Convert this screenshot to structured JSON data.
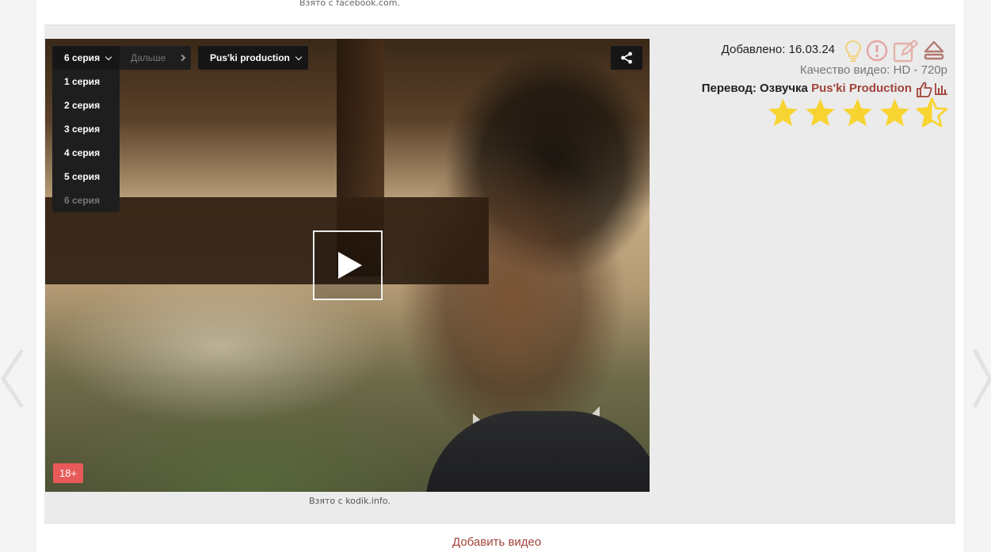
{
  "top_caption": "Взято с facebook.com.",
  "player": {
    "episode_selected": "6 серия",
    "next_label": "Дальше",
    "voice_selected": "Pus'ki production",
    "episodes": [
      "1 серия",
      "2 серия",
      "3 серия",
      "4 серия",
      "5 серия",
      "6 серия"
    ],
    "age_rating": "18+",
    "caption": "Взято с kodik.info."
  },
  "info": {
    "added_label": "Добавлено: 16.03.24",
    "quality_label": "Качество видео: HD - 720p",
    "translation_prefix": "Перевод: Озвучка",
    "translation_studio": "Pus'ki Production",
    "rating_stars": 4.5,
    "star_color": "#f7d431",
    "icon_color": "#b27770"
  },
  "add_video_label": "Добавить видео",
  "icons": [
    "lightbulb-icon",
    "warning-icon",
    "edit-icon",
    "eject-icon",
    "thumbs-up-icon",
    "bar-chart-icon",
    "share-icon",
    "play-icon",
    "prev-arrow-icon",
    "next-arrow-icon"
  ]
}
